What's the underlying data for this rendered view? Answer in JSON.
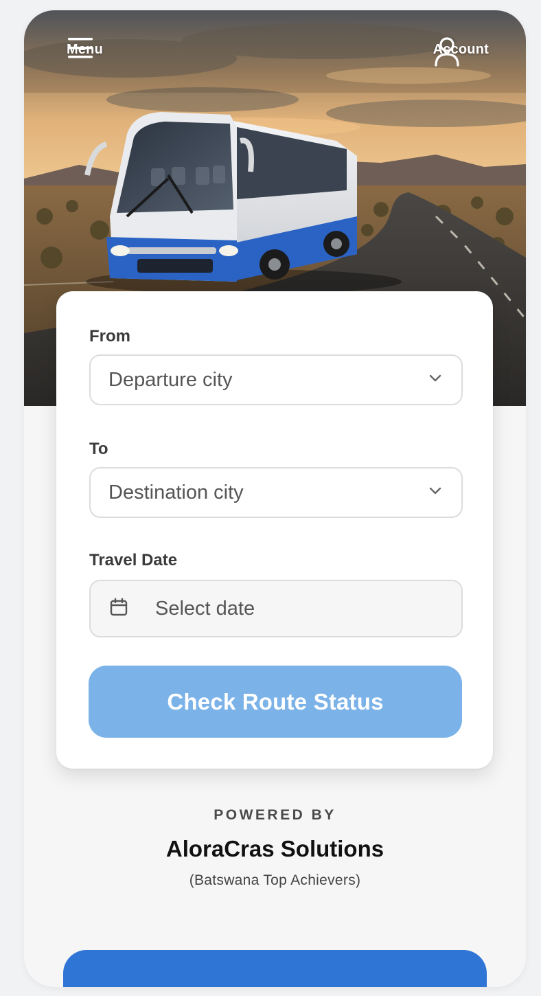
{
  "header": {
    "menu_label": "Menu",
    "account_label": "Account"
  },
  "form": {
    "from_label": "From",
    "from_value": "Departure city",
    "to_label": "To",
    "to_value": "Destination city",
    "date_label": "Travel Date",
    "date_placeholder": "Select date",
    "submit_label": "Check Route Status"
  },
  "footer": {
    "powered_by": "POWERED BY",
    "company": "AloraCras Solutions",
    "tagline": "(Batswana Top Achievers)"
  },
  "colors": {
    "primary_button": "#7bb2e8",
    "bottom_button": "#2f75d6",
    "bus_accent": "#2a63c4"
  },
  "icons": {
    "menu": "hamburger-icon",
    "account": "user-icon",
    "chevron": "chevron-down-icon",
    "date": "calendar-icon"
  }
}
